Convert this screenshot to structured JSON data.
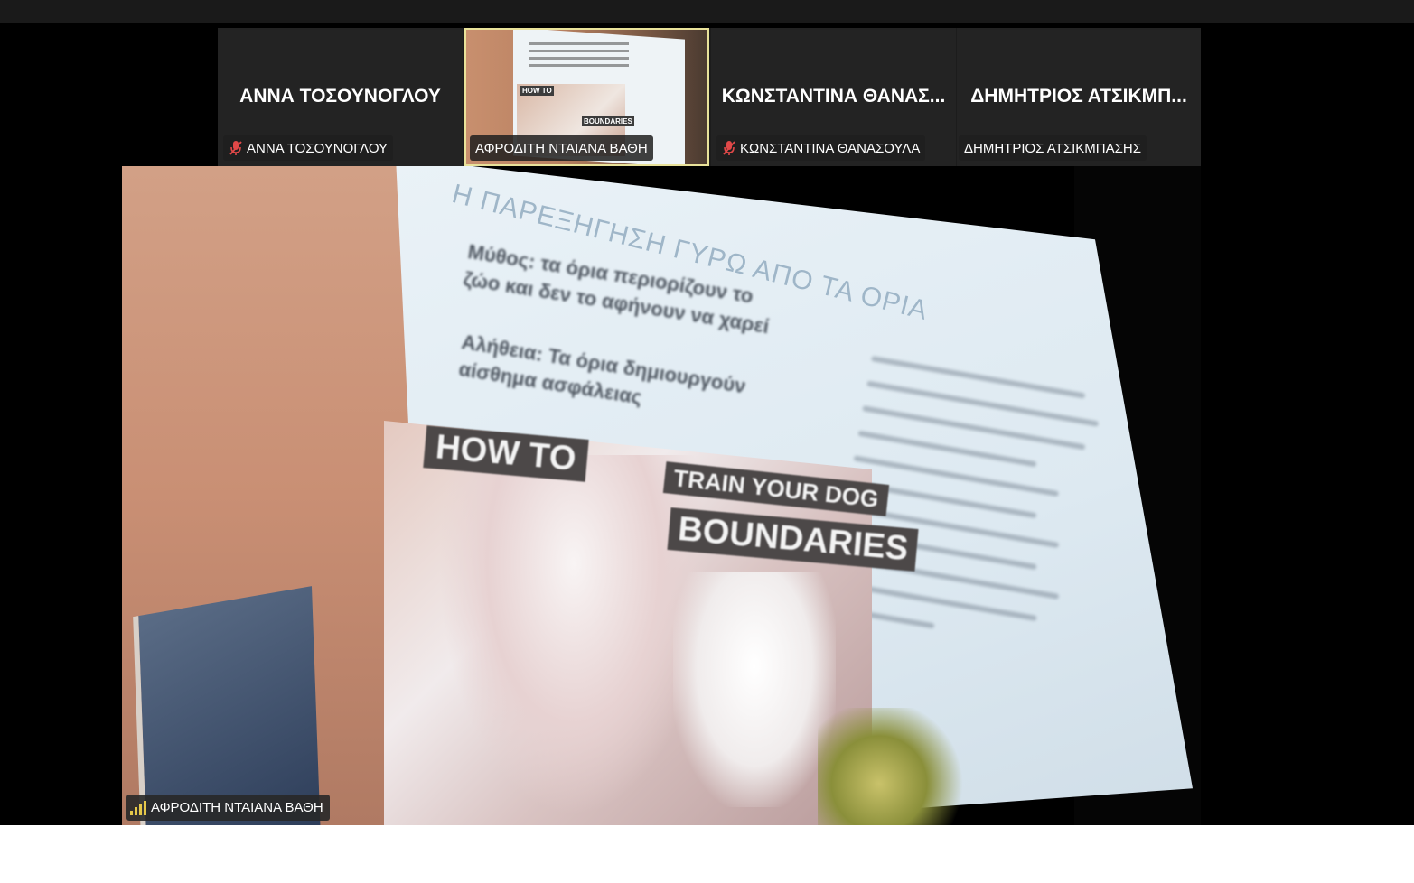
{
  "participants": [
    {
      "display_name": "ΑΝΝΑ ΤΟΣΟΥΝΟΓΛΟΥ",
      "tag_name": "ΑΝΝΑ ΤΟΣΟΥΝΟΓΛΟΥ",
      "muted": true
    },
    {
      "display_name": "",
      "tag_name": "ΑΦΡΟΔΙΤΗ ΝΤΑΙΑΝΑ ΒΑΘΗ",
      "muted": false,
      "active_speaker": true
    },
    {
      "display_name": "ΚΩΝΣΤΑΝΤΙΝΑ ΘΑΝΑΣ...",
      "tag_name": "ΚΩΝΣΤΑΝΤΙΝΑ ΘΑΝΑΣΟΥΛΑ",
      "muted": true
    },
    {
      "display_name": "ΔΗΜΗΤΡΙΟΣ ΑΤΣΙΚΜΠ...",
      "tag_name": "ΔΗΜΗΤΡΙΟΣ ΑΤΣΙΚΜΠΑΣΗΣ",
      "muted": false
    }
  ],
  "thumbnail": {
    "how_to": "HOW TO",
    "boundaries": "BOUNDARIES"
  },
  "main_video": {
    "speaker_name": "ΑΦΡΟΔΙΤΗ ΝΤΑΙΑΝΑ ΒΑΘΗ",
    "slide": {
      "title": "Η ΠΑΡΕΞΗΓΗΣΗ ΓΥΡΩ ΑΠΟ ΤΑ ΟΡΙΑ",
      "myth_line1": "Μύθος: τα όρια περιορίζουν το",
      "myth_line2": "ζώο και δεν το αφήνουν να χαρεί",
      "truth_line1": "Αλήθεια: Τα όρια δημιουργούν",
      "truth_line2": "αίσθημα ασφάλειας",
      "how_to": "HOW TO",
      "train": "TRAIN YOUR DOG",
      "boundaries": "BOUNDARIES"
    }
  },
  "colors": {
    "active_border": "#e9e29a",
    "muted_icon": "#e04848",
    "signal": "#e6c84a"
  }
}
